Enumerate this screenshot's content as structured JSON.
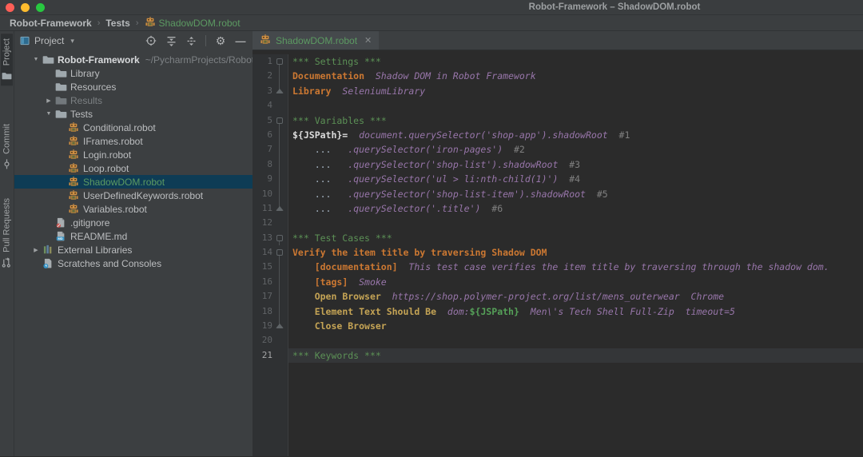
{
  "window": {
    "title": "Robot-Framework – ShadowDOM.robot"
  },
  "traffic_lights": {
    "close": "#FF5F57",
    "minimize": "#FEBC2E",
    "zoom": "#28C840"
  },
  "breadcrumb": {
    "items": [
      "Robot-Framework",
      "Tests"
    ],
    "separator": "›",
    "file": "ShadowDOM.robot"
  },
  "stripe": {
    "tabs": [
      {
        "label": "Project",
        "icon": "project-folder-icon",
        "selected": true
      },
      {
        "label": "Commit",
        "icon": "commit-icon",
        "selected": false
      },
      {
        "label": "Pull Requests",
        "icon": "pull-request-icon",
        "selected": false
      }
    ]
  },
  "project_panel": {
    "header": {
      "title": "Project",
      "dropdown_arrow": "▾",
      "icons": [
        "locate-icon",
        "collapse-all-icon",
        "expand-collapse-icon",
        "settings-gear-icon",
        "hide-icon"
      ]
    },
    "tree": [
      {
        "label": "Robot-Framework",
        "suffix": "~/PycharmProjects/Robot-Fram",
        "icon": "folder",
        "level": 0,
        "chevron": "open",
        "bold": true
      },
      {
        "label": "Library",
        "icon": "folder",
        "level": 1,
        "chevron": "none"
      },
      {
        "label": "Resources",
        "icon": "folder",
        "level": 1,
        "chevron": "none"
      },
      {
        "label": "Results",
        "icon": "folder",
        "level": 1,
        "chevron": "closed",
        "dim": true
      },
      {
        "label": "Tests",
        "icon": "folder",
        "level": 1,
        "chevron": "open"
      },
      {
        "label": "Conditional.robot",
        "icon": "robot",
        "level": 2,
        "chevron": "none"
      },
      {
        "label": "IFrames.robot",
        "icon": "robot",
        "level": 2,
        "chevron": "none"
      },
      {
        "label": "Login.robot",
        "icon": "robot",
        "level": 2,
        "chevron": "none"
      },
      {
        "label": "Loop.robot",
        "icon": "robot",
        "level": 2,
        "chevron": "none"
      },
      {
        "label": "ShadowDOM.robot",
        "icon": "robot",
        "level": 2,
        "chevron": "none",
        "selected": true
      },
      {
        "label": "UserDefinedKeywords.robot",
        "icon": "robot",
        "level": 2,
        "chevron": "none"
      },
      {
        "label": "Variables.robot",
        "icon": "robot",
        "level": 2,
        "chevron": "none"
      },
      {
        "label": ".gitignore",
        "icon": "gitignore",
        "level": 1,
        "chevron": "none"
      },
      {
        "label": "README.md",
        "icon": "readme",
        "level": 1,
        "chevron": "none"
      },
      {
        "label": "External Libraries",
        "icon": "extlib",
        "level": 0,
        "chevron": "closed"
      },
      {
        "label": "Scratches and Consoles",
        "icon": "scratch",
        "level": 0,
        "chevron": "none"
      }
    ]
  },
  "editor": {
    "tab": {
      "label": "ShadowDOM.robot",
      "close": "✕",
      "icon": "robot"
    },
    "current_line": 21,
    "lines": [
      {
        "n": 1,
        "f": "start",
        "s": [
          [
            "sec",
            "*** Settings ***"
          ]
        ]
      },
      {
        "n": 2,
        "f": "line",
        "s": [
          [
            "set",
            "Documentation"
          ],
          [
            "sp",
            "  "
          ],
          [
            "arg",
            "Shadow DOM in Robot Framework"
          ]
        ]
      },
      {
        "n": 3,
        "f": "end",
        "s": [
          [
            "set",
            "Library"
          ],
          [
            "sp",
            "  "
          ],
          [
            "arg",
            "SeleniumLibrary"
          ]
        ]
      },
      {
        "n": 4,
        "f": "",
        "s": []
      },
      {
        "n": 5,
        "f": "start",
        "s": [
          [
            "sec",
            "*** Variables ***"
          ]
        ]
      },
      {
        "n": 6,
        "f": "line",
        "s": [
          [
            "var",
            "${JSPath}="
          ],
          [
            "sp",
            "  "
          ],
          [
            "arg",
            "document.querySelector('shop-app').shadowRoot"
          ],
          [
            "sp",
            "  "
          ],
          [
            "com",
            "#1"
          ]
        ]
      },
      {
        "n": 7,
        "f": "line",
        "s": [
          [
            "sp",
            "    "
          ],
          [
            "dots",
            "..."
          ],
          [
            "sp",
            "   "
          ],
          [
            "arg",
            ".querySelector('iron-pages')"
          ],
          [
            "sp",
            "  "
          ],
          [
            "com",
            "#2"
          ]
        ]
      },
      {
        "n": 8,
        "f": "line",
        "s": [
          [
            "sp",
            "    "
          ],
          [
            "dots",
            "..."
          ],
          [
            "sp",
            "   "
          ],
          [
            "arg",
            ".querySelector('shop-list').shadowRoot"
          ],
          [
            "sp",
            "  "
          ],
          [
            "com",
            "#3"
          ]
        ]
      },
      {
        "n": 9,
        "f": "line",
        "s": [
          [
            "sp",
            "    "
          ],
          [
            "dots",
            "..."
          ],
          [
            "sp",
            "   "
          ],
          [
            "arg",
            ".querySelector('ul > li:nth-child(1)')"
          ],
          [
            "sp",
            "  "
          ],
          [
            "com",
            "#4"
          ]
        ]
      },
      {
        "n": 10,
        "f": "line",
        "s": [
          [
            "sp",
            "    "
          ],
          [
            "dots",
            "..."
          ],
          [
            "sp",
            "   "
          ],
          [
            "arg",
            ".querySelector('shop-list-item').shadowRoot"
          ],
          [
            "sp",
            "  "
          ],
          [
            "com",
            "#5"
          ]
        ]
      },
      {
        "n": 11,
        "f": "end",
        "s": [
          [
            "sp",
            "    "
          ],
          [
            "dots",
            "..."
          ],
          [
            "sp",
            "   "
          ],
          [
            "arg",
            ".querySelector('.title')"
          ],
          [
            "sp",
            "  "
          ],
          [
            "com",
            "#6"
          ]
        ]
      },
      {
        "n": 12,
        "f": "",
        "s": []
      },
      {
        "n": 13,
        "f": "start",
        "s": [
          [
            "sec",
            "*** Test Cases ***"
          ]
        ]
      },
      {
        "n": 14,
        "f": "start",
        "s": [
          [
            "tc",
            "Verify the item title by traversing Shadow DOM"
          ]
        ]
      },
      {
        "n": 15,
        "f": "line",
        "s": [
          [
            "sp",
            "    "
          ],
          [
            "set",
            "[documentation]"
          ],
          [
            "sp",
            "  "
          ],
          [
            "arg",
            "This test case verifies the item title by traversing through the shadow dom."
          ]
        ]
      },
      {
        "n": 16,
        "f": "line",
        "s": [
          [
            "sp",
            "    "
          ],
          [
            "set",
            "[tags]"
          ],
          [
            "sp",
            "  "
          ],
          [
            "arg",
            "Smoke"
          ]
        ]
      },
      {
        "n": 17,
        "f": "line",
        "s": [
          [
            "sp",
            "    "
          ],
          [
            "kw",
            "Open Browser"
          ],
          [
            "sp",
            "  "
          ],
          [
            "arg",
            "https://shop.polymer-project.org/list/mens_outerwear"
          ],
          [
            "sp",
            "  "
          ],
          [
            "arg",
            "Chrome"
          ]
        ]
      },
      {
        "n": 18,
        "f": "line",
        "s": [
          [
            "sp",
            "    "
          ],
          [
            "kw",
            "Element Text Should Be"
          ],
          [
            "sp",
            "  "
          ],
          [
            "arg",
            "dom:"
          ],
          [
            "gvar",
            "${JSPath}"
          ],
          [
            "sp",
            "  "
          ],
          [
            "arg",
            "Men\\'s Tech Shell Full-Zip"
          ],
          [
            "sp",
            "  "
          ],
          [
            "arg",
            "timeout=5"
          ]
        ]
      },
      {
        "n": 19,
        "f": "end",
        "s": [
          [
            "sp",
            "    "
          ],
          [
            "kw",
            "Close Browser"
          ]
        ]
      },
      {
        "n": 20,
        "f": "",
        "s": []
      },
      {
        "n": 21,
        "f": "",
        "s": [
          [
            "sec",
            "*** Keywords ***"
          ]
        ]
      }
    ]
  },
  "colors": {
    "selection_blue": "#0E3C55",
    "file_green": "#5C9A62",
    "section_green": "#5C9156",
    "keyword_orange": "#CC7832",
    "library_keyword_khaki": "#C5A455",
    "argument_purple": "#9876AA",
    "comment_gray": "#808080",
    "variable_green": "#55A058",
    "editor_bg": "#2B2B2B",
    "panel_bg": "#3C3F41",
    "current_line_bg": "#343638"
  }
}
